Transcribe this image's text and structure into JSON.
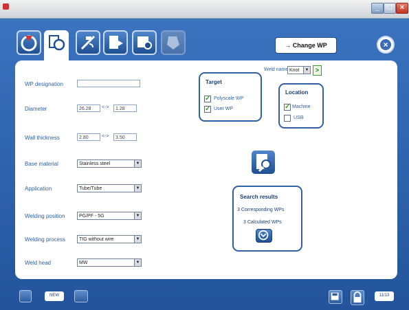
{
  "window": {
    "min_glyph": "_",
    "max_glyph": "□",
    "close_glyph": "×"
  },
  "toolbar": {
    "tabs": [
      {
        "icon": "stop-icon"
      },
      {
        "icon": "document-setup-icon"
      },
      {
        "icon": "weld-setup-icon"
      },
      {
        "icon": "document-export-icon"
      },
      {
        "icon": "settings-panel-icon"
      },
      {
        "icon": "tag-icon"
      }
    ],
    "change_wp_label": "→ Change WP",
    "close_glyph": "×"
  },
  "form": {
    "wp_designation_label": "WP designation",
    "wp_designation_value": "",
    "diameter_label": "Diameter",
    "diameter_from": "26.28",
    "diameter_sep": "<->",
    "diameter_to": "1.28",
    "wall_thickness_label": "Wall thickness",
    "wall_from": "2.80",
    "wall_sep": "<->",
    "wall_to": "3.50",
    "base_material_label": "Base material",
    "base_material_value": "Stainless steel",
    "application_label": "Application",
    "application_value": "Tube/Tube",
    "welding_position_label": "Welding position",
    "welding_position_value": "PG/PF - 5G",
    "welding_process_label": "Welding process",
    "welding_process_value": "TIG without wire",
    "weld_head_label": "Weld head",
    "weld_head_value": "MW"
  },
  "weld_name": {
    "label": "Weld name",
    "value": "Knot",
    "arrow": ">"
  },
  "target": {
    "title": "Target",
    "options": [
      {
        "label": "Polyscale WP",
        "checked": true
      },
      {
        "label": "User WP",
        "checked": true
      }
    ]
  },
  "location": {
    "title": "Location",
    "options": [
      {
        "label": "Machine",
        "checked": true
      },
      {
        "label": "USB",
        "checked": false
      }
    ]
  },
  "search_results": {
    "title": "Search results",
    "corresponding": "3 Corresponding WPs",
    "calculated": "3 Calculated WPs"
  },
  "bottom": {
    "small_button_label": "NEW",
    "version_label": "11/13"
  },
  "colors": {
    "frame_blue": "#2d5fa8",
    "label_blue": "#2f5fa5",
    "check_green": "#3a9a2a"
  }
}
